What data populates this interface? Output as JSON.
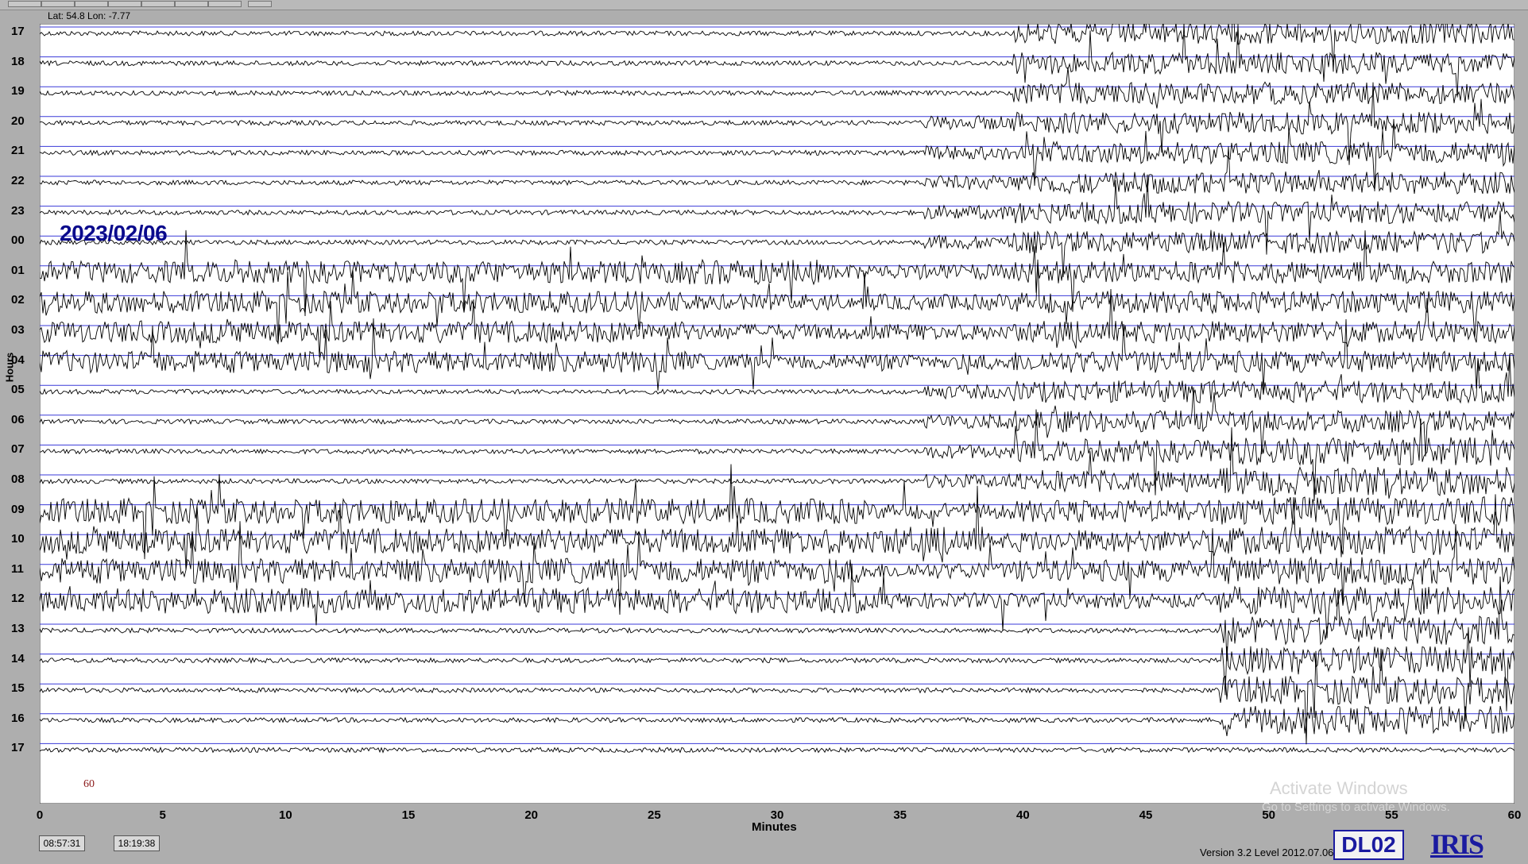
{
  "header": {
    "coordinates": "Lat: 54.8 Lon: -7.77"
  },
  "y_axis": {
    "label": "Hours",
    "hour_labels": [
      "17",
      "18",
      "19",
      "20",
      "21",
      "22",
      "23",
      "00",
      "01",
      "02",
      "03",
      "04",
      "05",
      "06",
      "07",
      "08",
      "09",
      "10",
      "11",
      "12",
      "13",
      "14",
      "15",
      "16",
      "17"
    ]
  },
  "x_axis": {
    "label": "Minutes",
    "tick_labels": [
      "0",
      "5",
      "10",
      "15",
      "20",
      "25",
      "30",
      "35",
      "40",
      "45",
      "50",
      "55",
      "60"
    ]
  },
  "plot": {
    "date": "2023/02/06",
    "scale": "60",
    "trace_color": "#000000",
    "line_color": "#3a3ad8",
    "background": "#ffffff"
  },
  "footer": {
    "start_time": "08:57:31",
    "current_time": "18:19:38",
    "version": "Version 3.2 Level 2012.07.06",
    "station": "DL02",
    "logo": "IRIS"
  },
  "watermark": {
    "line1": "Activate Windows",
    "line2": "Go to Settings to activate Windows."
  }
}
